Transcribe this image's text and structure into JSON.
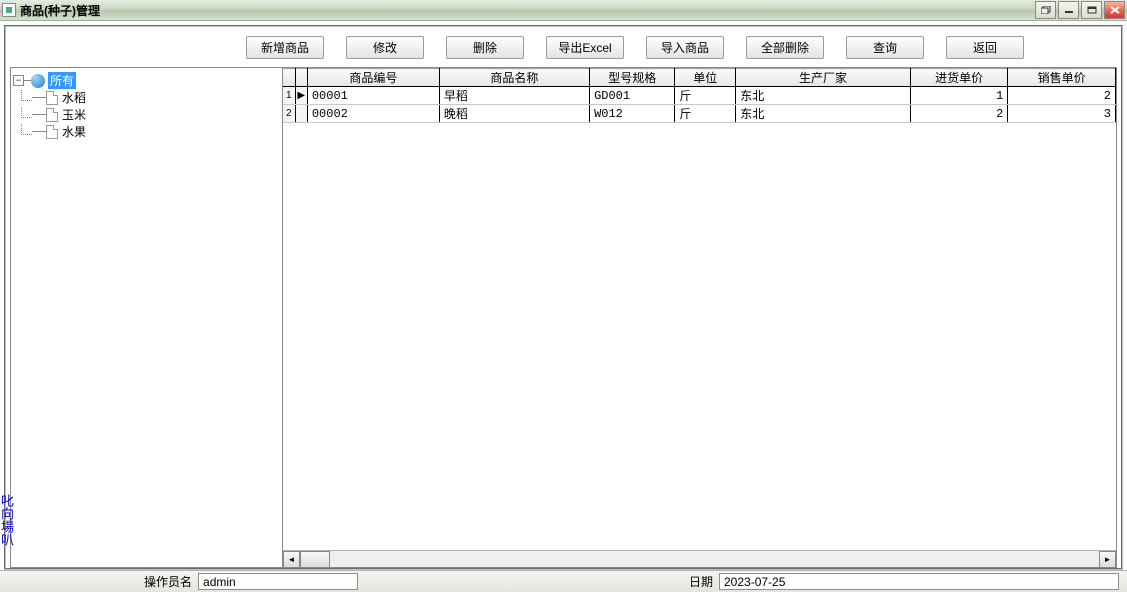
{
  "window": {
    "title": "商品(种子)管理"
  },
  "toolbar": {
    "add": "新增商品",
    "edit": "修改",
    "delete": "删除",
    "export": "导出Excel",
    "import": "导入商品",
    "deleteAll": "全部删除",
    "query": "查询",
    "back": "返回"
  },
  "tree": {
    "root": "所有",
    "children": [
      "水稻",
      "玉米",
      "水果"
    ]
  },
  "grid": {
    "columns": [
      "商品编号",
      "商品名称",
      "型号规格",
      "单位",
      "生产厂家",
      "进货单价",
      "销售单价"
    ],
    "rows": [
      {
        "id": "00001",
        "name": "早稻",
        "spec": "GD001",
        "unit": "斤",
        "maker": "东北",
        "pin": "1",
        "pout": "2"
      },
      {
        "id": "00002",
        "name": "晚稻",
        "spec": "W012",
        "unit": "斤",
        "maker": "东北",
        "pin": "2",
        "pout": "3"
      }
    ]
  },
  "left_vert": "叱向場叭",
  "status": {
    "operator_label": "操作员名",
    "operator_value": "admin",
    "date_label": "日期",
    "date_value": "2023-07-25"
  }
}
